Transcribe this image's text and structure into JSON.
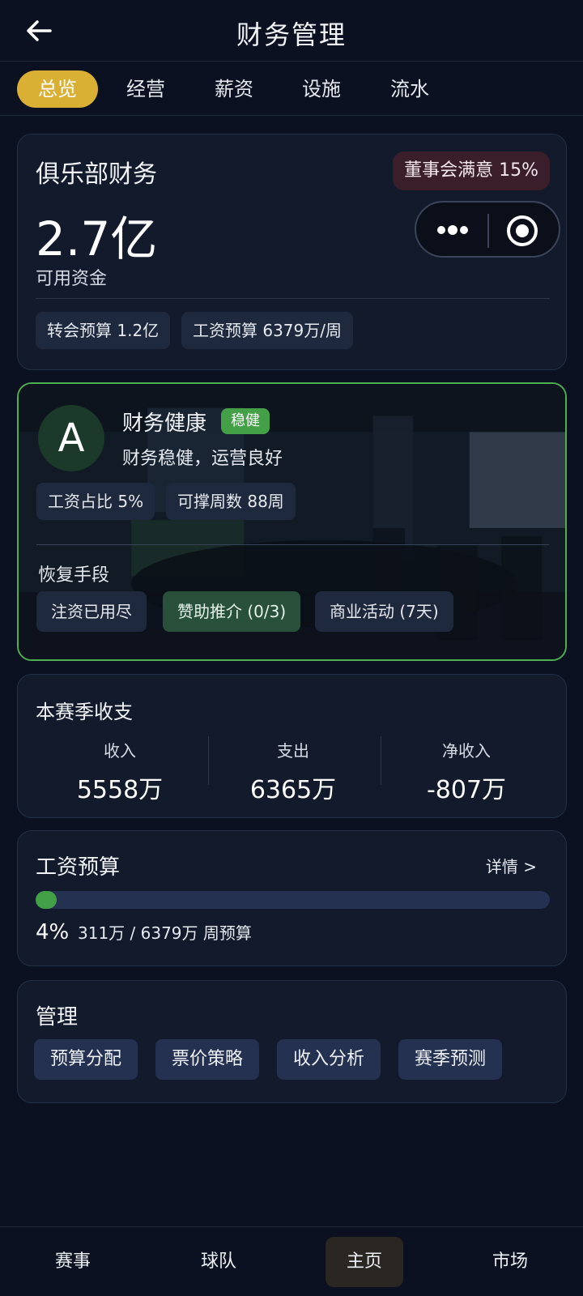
{
  "header": {
    "title": "财务管理"
  },
  "tabs": [
    {
      "label": "总览"
    },
    {
      "label": "经营"
    },
    {
      "label": "薪资"
    },
    {
      "label": "设施"
    },
    {
      "label": "流水"
    }
  ],
  "finance": {
    "title": "俱乐部财务",
    "board_satisfaction": "董事会满意 15%",
    "amount": "2.7亿",
    "amount_label": "可用资金",
    "transfer_budget": "转会预算 1.2亿",
    "wage_budget": "工资预算 6379万/周"
  },
  "health": {
    "grade": "A",
    "title": "财务健康",
    "status_badge": "稳健",
    "description": "财务稳健，运营良好",
    "wage_ratio": "工资占比 5%",
    "weeks": "可撑周数 88周",
    "recovery_title": "恢复手段",
    "recovery": [
      {
        "label": "注资已用尽"
      },
      {
        "label": "赞助推介 (0/3)"
      },
      {
        "label": "商业活动 (7天)"
      }
    ]
  },
  "season": {
    "title": "本赛季收支",
    "stats": [
      {
        "label": "收入",
        "value": "5558万"
      },
      {
        "label": "支出",
        "value": "6365万"
      },
      {
        "label": "净收入",
        "value": "-807万"
      }
    ]
  },
  "salary": {
    "title": "工资预算",
    "details": "详情 >",
    "percent_text": "4%",
    "percent_value": 0.04,
    "subtext": "311万 / 6379万 周预算"
  },
  "management": {
    "title": "管理",
    "buttons": [
      {
        "label": "预算分配"
      },
      {
        "label": "票价策略"
      },
      {
        "label": "收入分析"
      },
      {
        "label": "赛季预测"
      }
    ]
  },
  "bottom_nav": [
    {
      "label": "赛事"
    },
    {
      "label": "球队"
    },
    {
      "label": "主页"
    },
    {
      "label": "市场"
    }
  ],
  "colors": {
    "accent_gold": "#d9b034",
    "healthy_green": "#43a047",
    "background": "#0b1120"
  }
}
